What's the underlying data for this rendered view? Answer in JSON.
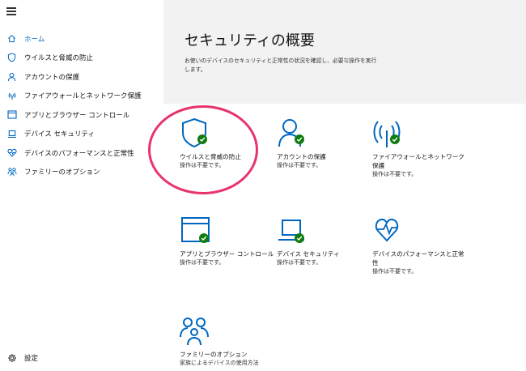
{
  "sidebar": {
    "items": [
      {
        "label": "ホーム",
        "icon": "home-icon"
      },
      {
        "label": "ウイルスと脅威の防止",
        "icon": "shield-icon"
      },
      {
        "label": "アカウントの保護",
        "icon": "person-icon"
      },
      {
        "label": "ファイアウォールとネットワーク保護",
        "icon": "wifi-signal-icon"
      },
      {
        "label": "アプリとブラウザー コントロール",
        "icon": "app-window-icon"
      },
      {
        "label": "デバイス セキュリティ",
        "icon": "laptop-icon"
      },
      {
        "label": "デバイスのパフォーマンスと正常性",
        "icon": "heart-icon"
      },
      {
        "label": "ファミリーのオプション",
        "icon": "family-icon"
      }
    ],
    "settings_label": "設定"
  },
  "main": {
    "title": "セキュリティの概要",
    "subtitle": "お使いのデバイスのセキュリティと正常性の状況を確認し、必要な操作を実行します。"
  },
  "cards": [
    {
      "title": "ウイルスと脅威の防止",
      "status": "操作は不要です。",
      "icon": "shield-icon"
    },
    {
      "title": "アカウントの保護",
      "status": "操作は不要です。",
      "icon": "person-icon"
    },
    {
      "title": "ファイアウォールとネットワーク保護",
      "status": "操作は不要です。",
      "icon": "wifi-signal-icon"
    },
    {
      "title": "アプリとブラウザー コントロール",
      "status": "操作は不要です。",
      "icon": "app-window-icon"
    },
    {
      "title": "デバイス セキュリティ",
      "status": "操作は不要です。",
      "icon": "laptop-icon"
    },
    {
      "title": "デバイスのパフォーマンスと正常性",
      "status": "操作は不要です。",
      "icon": "heart-icon"
    },
    {
      "title": "ファミリーのオプション",
      "status": "家族によるデバイスの使用方法",
      "icon": "family-icon"
    }
  ],
  "colors": {
    "accent": "#0067c0",
    "ok": "#107c10",
    "highlight": "#e8336b"
  }
}
